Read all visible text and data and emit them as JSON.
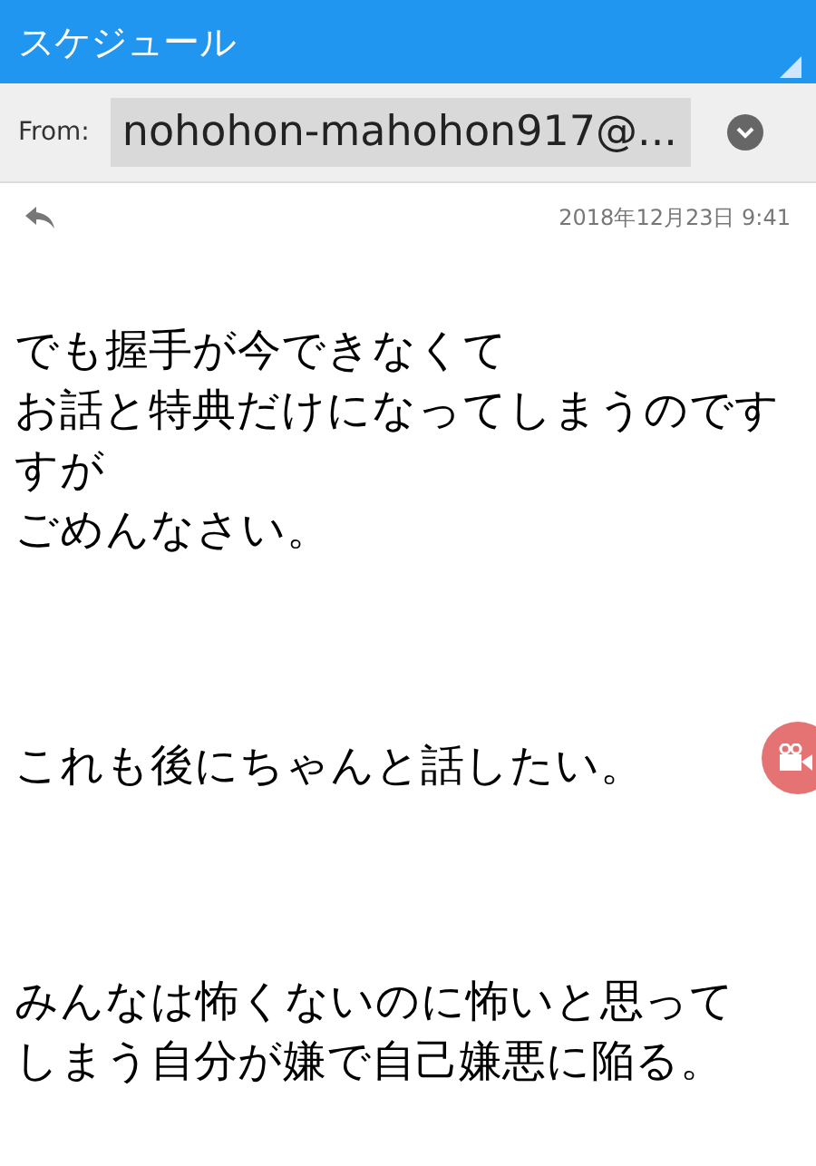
{
  "header": {
    "title": "スケジュール"
  },
  "from": {
    "label": "From:",
    "address": "nohohon-mahohon917@..."
  },
  "meta": {
    "date": "2018年12月23日 9:41"
  },
  "body": [
    {
      "lines": [
        "でも握手が今できなくて",
        "お話と特典だけになってしまうのです",
        "すが",
        "ごめんなさい。"
      ]
    },
    {
      "lines": [
        "これも後にちゃんと話したい。"
      ]
    },
    {
      "lines": [
        "みんなは怖くないのに怖いと思って",
        "しまう自分が嫌で自己嫌悪に陥る。"
      ]
    }
  ]
}
